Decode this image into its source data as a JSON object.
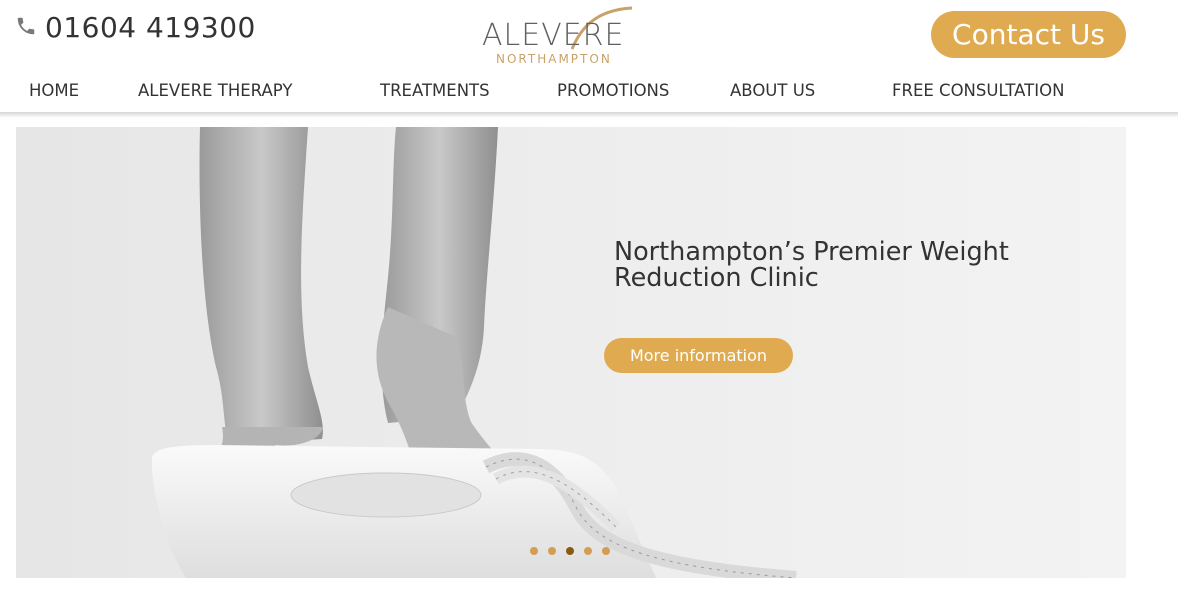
{
  "header": {
    "phone": "01604 419300",
    "phone_icon": "phone-icon",
    "logo": {
      "main": "ALEVERE",
      "sub": "NORTHAMPTON"
    },
    "contact_label": "Contact Us",
    "accent_color": "#e0ab50"
  },
  "nav": {
    "items": [
      {
        "label": "HOME"
      },
      {
        "label": "ALEVERE THERAPY"
      },
      {
        "label": "TREATMENTS"
      },
      {
        "label": "PROMOTIONS"
      },
      {
        "label": "ABOUT US"
      },
      {
        "label": "FREE CONSULTATION"
      }
    ]
  },
  "hero": {
    "headline": "Northampton’s Premier Weight Reduction Clinic",
    "button_label": "More information",
    "slides_total": 5,
    "active_slide": 3
  }
}
